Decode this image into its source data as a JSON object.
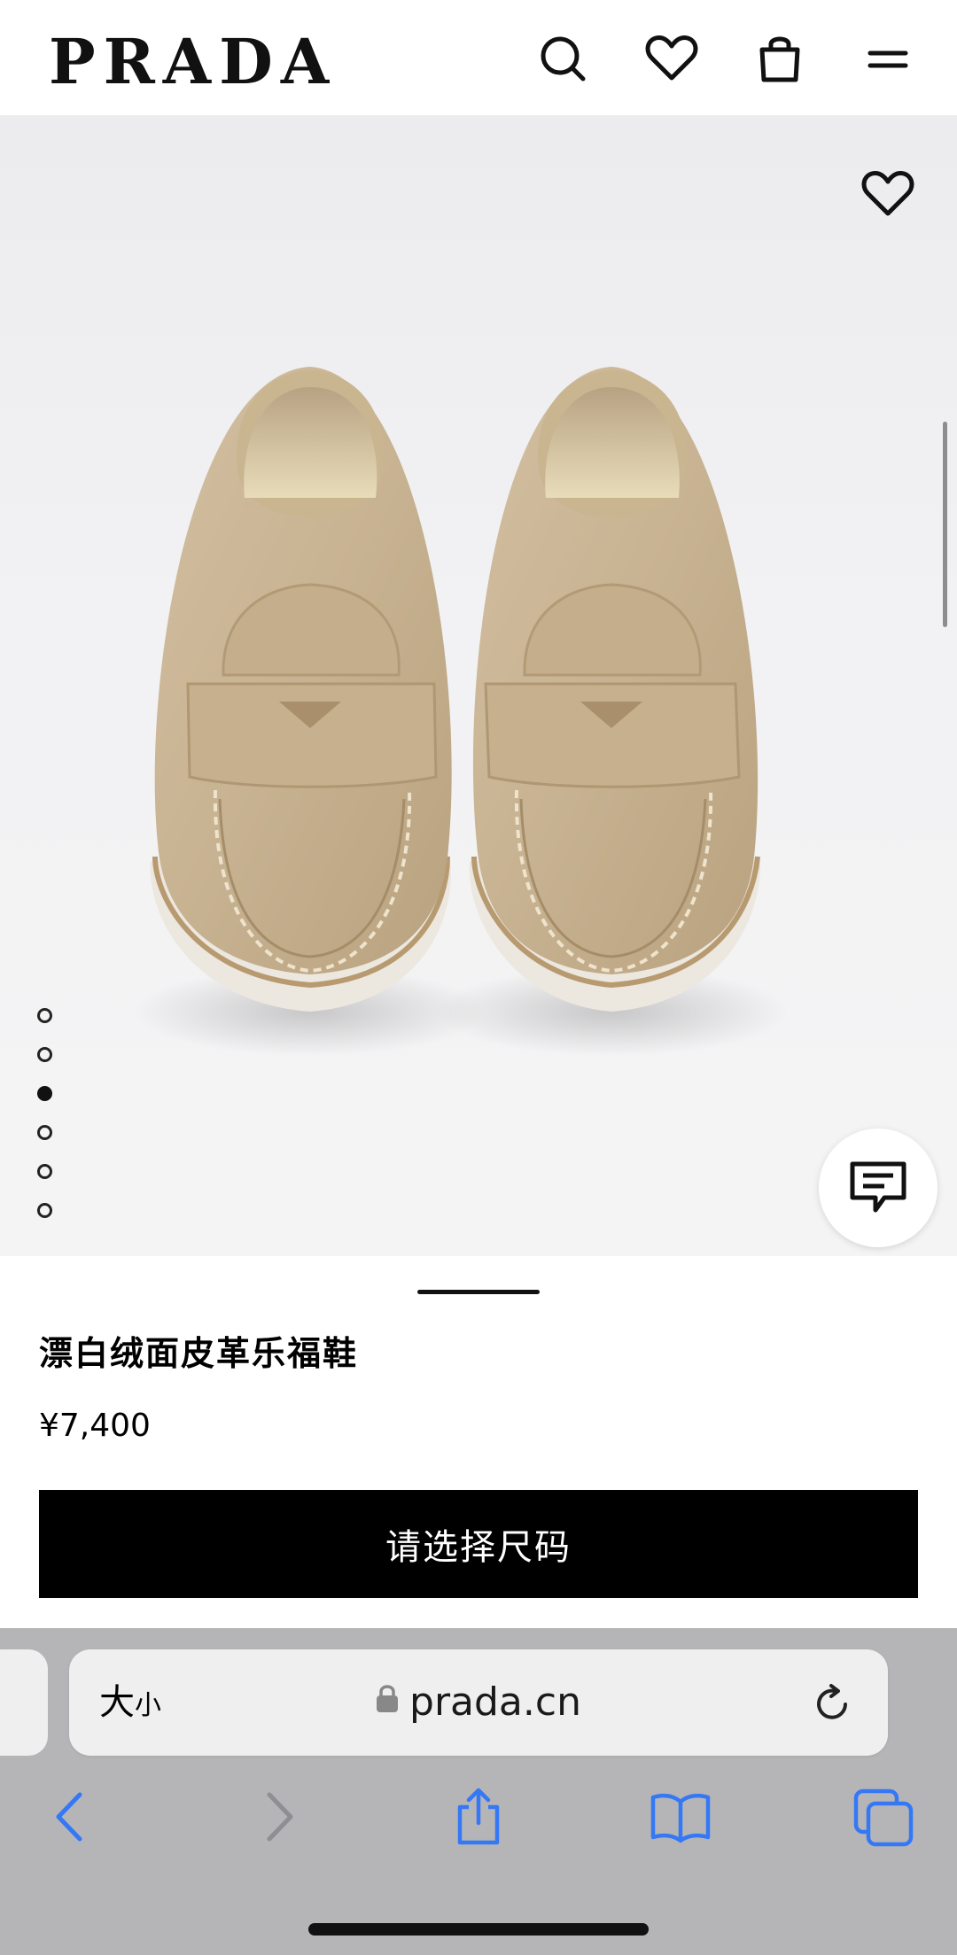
{
  "header": {
    "logo": "PRADA",
    "icons": [
      "search-icon",
      "heart-icon",
      "shopping-bag-icon",
      "menu-icon"
    ]
  },
  "gallery": {
    "image_alt": "漂白绒面皮革乐福鞋",
    "dot_count": 6,
    "active_index": 2,
    "favorite_icon": "heart-icon",
    "chat_icon": "chat-icon"
  },
  "product": {
    "name": "漂白绒面皮革乐福鞋",
    "price": "¥7,400",
    "cta_label": "请选择尺码"
  },
  "browser": {
    "text_size_big": "大",
    "text_size_small": "小",
    "url": "prada.cn"
  },
  "colors": {
    "accent": "#000000",
    "chrome_bg": "#b5b5b7",
    "ios_blue": "#3478f6",
    "suede": "#c8b393"
  }
}
